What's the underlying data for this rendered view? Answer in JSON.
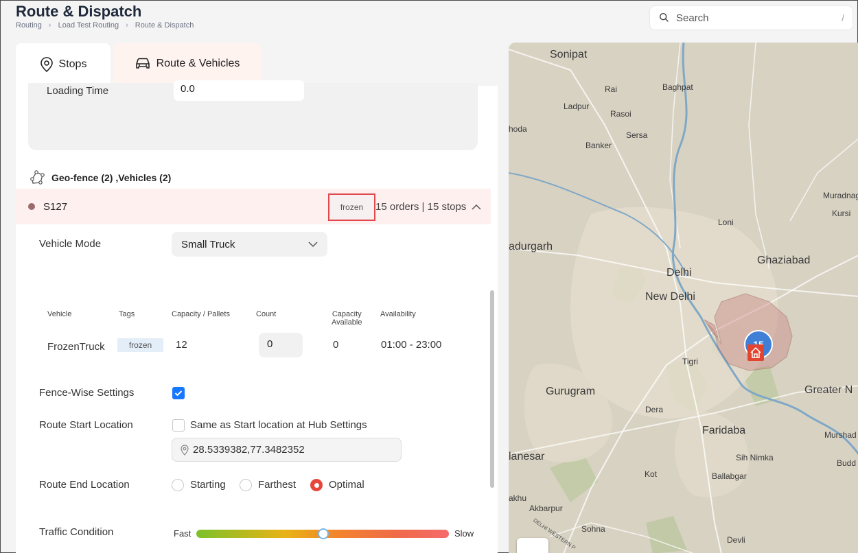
{
  "header": {
    "title": "Route & Dispatch",
    "breadcrumb": [
      "Routing",
      "Load Test Routing",
      "Route & Dispatch"
    ]
  },
  "search": {
    "placeholder": "Search",
    "shortcut": "/"
  },
  "tabs": [
    {
      "label": "Stops",
      "icon": "location-pin-icon",
      "active": false
    },
    {
      "label": "Route & Vehicles",
      "icon": "car-icon",
      "active": true
    }
  ],
  "loading": {
    "label": "Loading Time",
    "value": "0.0"
  },
  "geofence": {
    "title": "Geo-fence (2) ,Vehicles (2)"
  },
  "fence": {
    "name": "S127",
    "tag": "frozen",
    "summary": "15 orders | 15 stops"
  },
  "vehicle_mode": {
    "label": "Vehicle Mode",
    "value": "Small Truck"
  },
  "vehicle_table": {
    "headers": {
      "vehicle": "Vehicle",
      "tags": "Tags",
      "capacity": "Capacity / Pallets",
      "count": "Count",
      "cap_available_1": "Capacity",
      "cap_available_2": "Available",
      "availability": "Availability"
    },
    "rows": [
      {
        "vehicle": "FrozenTruck",
        "tag": "frozen",
        "capacity": "12",
        "count": "0",
        "available": "0",
        "availability": "01:00 - 23:00"
      }
    ]
  },
  "fence_wise": {
    "label": "Fence-Wise Settings",
    "checked": true
  },
  "route_start": {
    "label": "Route Start Location",
    "checkbox_label": "Same as Start location at Hub Settings",
    "checked": false,
    "coordinates": "28.5339382,77.3482352"
  },
  "route_end": {
    "label": "Route End Location",
    "options": [
      "Starting",
      "Farthest",
      "Optimal"
    ],
    "selected": "Optimal"
  },
  "traffic": {
    "label": "Traffic Condition",
    "min_label": "Fast",
    "max_label": "Slow",
    "level": 0.5
  },
  "map": {
    "labels": {
      "sonipat": "Sonipat",
      "baghpat": "Baghpat",
      "rai": "Rai",
      "ladpur": "Ladpur",
      "rasoi": "Rasoi",
      "hoda": "hoda",
      "sersa": "Sersa",
      "banker": "Banker",
      "muradnagar": "Muradnaga",
      "kursi": "Kursi",
      "loni": "Loni",
      "bahadurgarh": "adurgarh",
      "ghaziabad": "Ghaziabad",
      "delhi": "Delhi",
      "new_delhi": "New Delhi",
      "tigri": "Tigri",
      "gurugram": "Gurugram",
      "greater_noida": "Greater N",
      "dera": "Dera",
      "faridabad": "Faridaba",
      "murshad": "Murshad",
      "jhajjar": "lanesar",
      "sihnimka": "Sih Nimka",
      "kot": "Kot",
      "ballabgarh": "Ballabgar",
      "buddha": "Budd",
      "sakhu": "akhu",
      "akbarpur": "Akbarpur",
      "sohna": "Sohna",
      "devli": "Devli",
      "highway": "DELHI WESTERN P"
    },
    "cluster_count": "15",
    "colors": {
      "geofence": "#c98a86",
      "cluster": "#3f7fd6",
      "hub": "#e2452f"
    }
  }
}
